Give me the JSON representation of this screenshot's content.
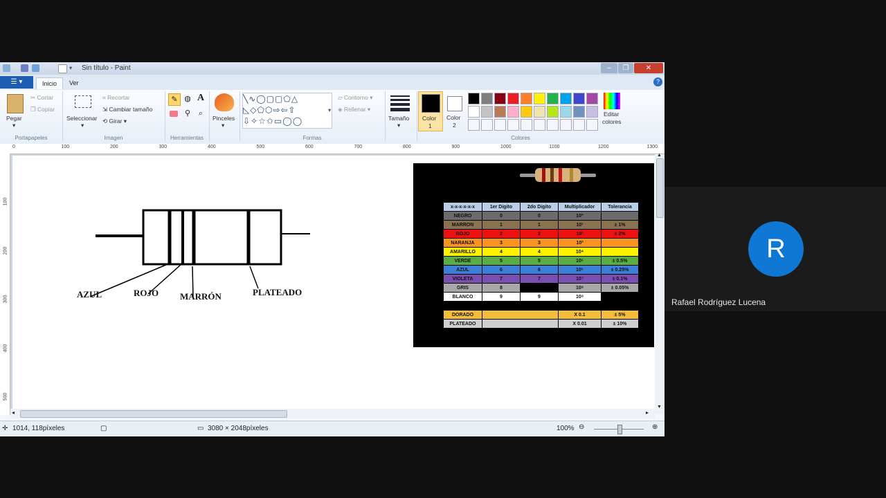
{
  "window": {
    "title": "Sin título - Paint",
    "file_tab": "▾",
    "tabs": [
      "Inicio",
      "Ver"
    ]
  },
  "ribbon": {
    "portapapeles": {
      "paste": "Pegar",
      "cut": "Cortar",
      "copy": "Copiar",
      "label": "Portapapeles"
    },
    "imagen": {
      "select": "Seleccionar",
      "crop": "Recortar",
      "resize": "Cambiar tamaño",
      "rotate": "Girar",
      "label": "Imagen"
    },
    "herramientas": {
      "label": "Herramientas"
    },
    "pinceles": {
      "label": "Pinceles"
    },
    "formas": {
      "outline": "Contorno",
      "fill": "Rellenar",
      "label": "Formas"
    },
    "tamano": {
      "label": "Tamaño"
    },
    "colores": {
      "color1": "Color",
      "color1_num": "1",
      "color2": "Color",
      "color2_num": "2",
      "edit": "Editar",
      "edit2": "colores",
      "label": "Colores",
      "palette_row1": [
        "#000000",
        "#7f7f7f",
        "#880015",
        "#ed1c24",
        "#ff7f27",
        "#fff200",
        "#22b14c",
        "#00a2e8",
        "#3f48cc",
        "#a349a4"
      ],
      "palette_row2": [
        "#ffffff",
        "#c3c3c3",
        "#b97a57",
        "#ffaec9",
        "#ffc90e",
        "#efe4b0",
        "#b5e61d",
        "#99d9ea",
        "#7092be",
        "#c8bfe7"
      ]
    }
  },
  "rulers": {
    "horizontal": [
      "0",
      "100",
      "200",
      "300",
      "400",
      "500",
      "600",
      "700",
      "800",
      "900",
      "1000",
      "1100",
      "1200",
      "1300"
    ],
    "vertical": [
      "100",
      "200",
      "300",
      "400",
      "500"
    ]
  },
  "drawing": {
    "labels": {
      "blue": "AZUL",
      "red": "ROJO",
      "brown": "MARRÓN",
      "silver": "PLATEADO"
    }
  },
  "color_code_table": {
    "headers": [
      "x-x-x-x-x-x",
      "1er Digito",
      "2do Digito",
      "Multiplicador",
      "Tolerancia"
    ],
    "rows": [
      {
        "name": "NEGRO",
        "d1": "0",
        "d2": "0",
        "mult": "10⁰",
        "tol": "",
        "bg": "#6b6b6b"
      },
      {
        "name": "MARRON",
        "d1": "1",
        "d2": "1",
        "mult": "10¹",
        "tol": "± 1%",
        "bg": "#8a7150"
      },
      {
        "name": "ROJO",
        "d1": "2",
        "d2": "2",
        "mult": "10²",
        "tol": "± 2%",
        "bg": "#ee1111"
      },
      {
        "name": "NARANJA",
        "d1": "3",
        "d2": "3",
        "mult": "10³",
        "tol": "",
        "bg": "#f7931e"
      },
      {
        "name": "AMARILLO",
        "d1": "4",
        "d2": "4",
        "mult": "10⁴",
        "tol": "",
        "bg": "#fff200"
      },
      {
        "name": "VERDE",
        "d1": "5",
        "d2": "5",
        "mult": "10⁵",
        "tol": "± 0.5%",
        "bg": "#5aac44"
      },
      {
        "name": "AZUL",
        "d1": "6",
        "d2": "6",
        "mult": "10⁶",
        "tol": "± 0.25%",
        "bg": "#3d7fd6"
      },
      {
        "name": "VIOLETA",
        "d1": "7",
        "d2": "7",
        "mult": "10⁷",
        "tol": "± 0.1%",
        "bg": "#7a4fb0"
      },
      {
        "name": "GRIS",
        "d1": "8",
        "d2": "",
        "mult": "10⁸",
        "tol": "± 0.05%",
        "bg": "#a8a8a8"
      },
      {
        "name": "BLANCO",
        "d1": "9",
        "d2": "9",
        "mult": "10⁹",
        "tol": "",
        "bg": "#ffffff"
      }
    ],
    "extra_rows": [
      {
        "name": "DORADO",
        "mult": "X 0.1",
        "tol": "± 5%",
        "bg": "#f3bd3a"
      },
      {
        "name": "PLATEADO",
        "mult": "X 0.01",
        "tol": "± 10%",
        "bg": "#cfcfcf"
      }
    ]
  },
  "status": {
    "cursor": "1014, 118píxeles",
    "size": "3080 × 2048píxeles",
    "zoom": "100%"
  },
  "participant": {
    "initial": "R",
    "name": "Rafael Rodríguez Lucena"
  }
}
